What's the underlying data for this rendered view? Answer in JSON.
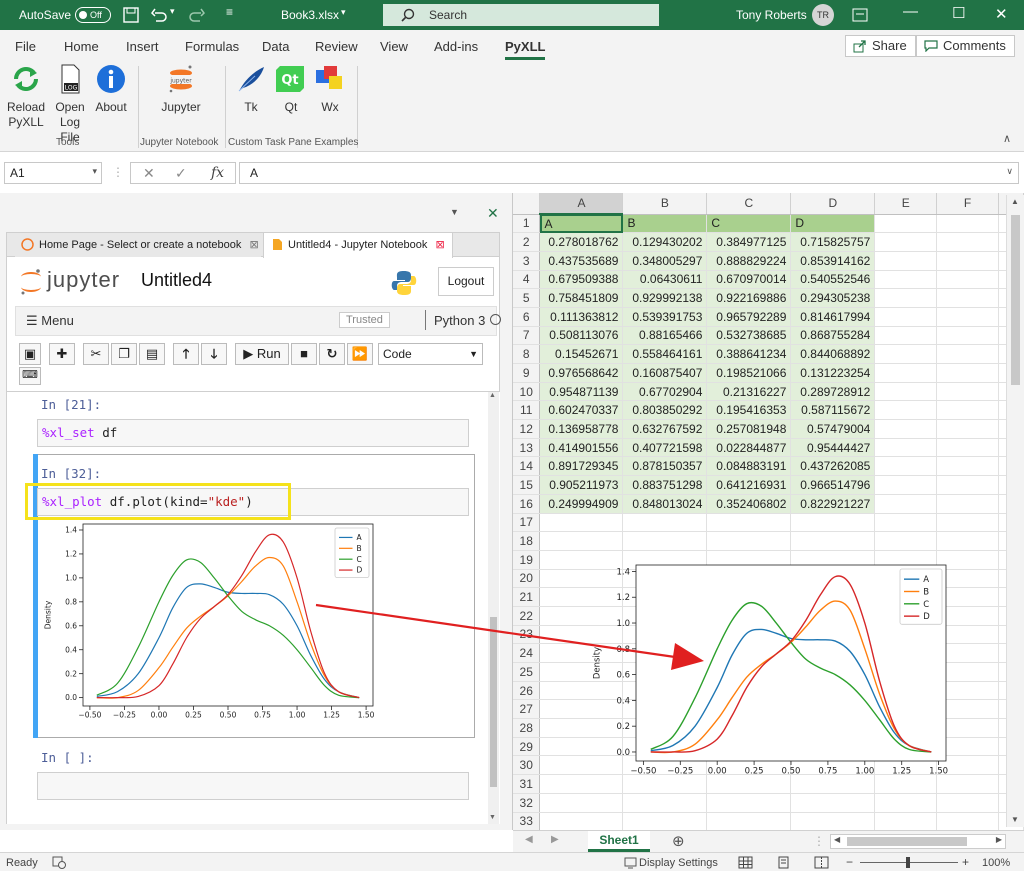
{
  "titlebar": {
    "autosave_label": "AutoSave",
    "autosave_state": "Off",
    "filename": "Book3.xlsx",
    "search_placeholder": "Search",
    "user": "Tony Roberts",
    "initials": "TR"
  },
  "menu": {
    "items": [
      "File",
      "Home",
      "Insert",
      "Formulas",
      "Data",
      "Review",
      "View",
      "Add-ins",
      "PyXLL"
    ],
    "active": "PyXLL",
    "share": "Share",
    "comments": "Comments"
  },
  "ribbon": {
    "buttons": [
      {
        "label1": "Reload",
        "label2": "PyXLL"
      },
      {
        "label1": "Open",
        "label2": "Log File"
      },
      {
        "label1": "About",
        "label2": ""
      },
      {
        "label1": "Jupyter",
        "label2": ""
      },
      {
        "label1": "Tk",
        "label2": ""
      },
      {
        "label1": "Qt",
        "label2": ""
      },
      {
        "label1": "Wx",
        "label2": ""
      }
    ],
    "groups": [
      "Tools",
      "Jupyter Notebook",
      "Custom Task Pane Examples"
    ]
  },
  "formula_bar": {
    "cell_ref": "A1",
    "content": "A"
  },
  "sheet": {
    "columns": [
      "A",
      "B",
      "C",
      "D",
      "E",
      "F"
    ],
    "headers": [
      "A",
      "B",
      "C",
      "D"
    ],
    "rows": [
      [
        "0.278018762",
        "0.129430202",
        "0.384977125",
        "0.715825757"
      ],
      [
        "0.437535689",
        "0.348005297",
        "0.888829224",
        "0.853914162"
      ],
      [
        "0.679509388",
        "0.06430611",
        "0.670970014",
        "0.540552546"
      ],
      [
        "0.758451809",
        "0.929992138",
        "0.922169886",
        "0.294305238"
      ],
      [
        "0.111363812",
        "0.539391753",
        "0.965792289",
        "0.814617994"
      ],
      [
        "0.508113076",
        "0.88165466",
        "0.532738685",
        "0.868755284"
      ],
      [
        "0.15452671",
        "0.558464161",
        "0.388641234",
        "0.844068892"
      ],
      [
        "0.976568642",
        "0.160875407",
        "0.198521066",
        "0.131223254"
      ],
      [
        "0.954871139",
        "0.67702904",
        "0.21316227",
        "0.289728912"
      ],
      [
        "0.602470337",
        "0.803850292",
        "0.195416353",
        "0.587115672"
      ],
      [
        "0.136958778",
        "0.632767592",
        "0.257081948",
        "0.57479004"
      ],
      [
        "0.414901556",
        "0.407721598",
        "0.022844877",
        "0.95444427"
      ],
      [
        "0.891729345",
        "0.878150357",
        "0.084883191",
        "0.437262085"
      ],
      [
        "0.905211973",
        "0.883751298",
        "0.641216931",
        "0.966514796"
      ],
      [
        "0.249994909",
        "0.848013024",
        "0.352406802",
        "0.822921227"
      ]
    ],
    "row_numbers": [
      "1",
      "2",
      "3",
      "4",
      "5",
      "6",
      "7",
      "8",
      "9",
      "10",
      "11",
      "12",
      "13",
      "14",
      "15",
      "16",
      "17",
      "18",
      "19",
      "20",
      "21",
      "22",
      "23",
      "24",
      "25",
      "26",
      "27",
      "28",
      "29",
      "30",
      "31",
      "32",
      "33"
    ],
    "tab": "Sheet1"
  },
  "status": {
    "ready": "Ready",
    "display_settings": "Display Settings",
    "zoom": "100%"
  },
  "browser": {
    "tabs": [
      "Home Page - Select or create a notebook",
      "Untitled4 - Jupyter Notebook"
    ]
  },
  "jupyter": {
    "logo_text": "jupyter",
    "notebook_name": "Untitled4",
    "logout": "Logout",
    "menu_label": "Menu",
    "trusted": "Trusted",
    "kernel": "Python 3",
    "run_label": "Run",
    "cell_type": "Code",
    "cells": [
      {
        "prompt": "In [21]:",
        "magic": "%xl_set",
        "code": " df"
      },
      {
        "prompt": "In [32]:",
        "magic": "%xl_plot",
        "code": " df.plot(kind=",
        "string": "\"kde\"",
        "close": ")"
      },
      {
        "prompt": "In [ ]:",
        "code": ""
      }
    ]
  },
  "colors": {
    "excel_green": "#217346",
    "series": [
      "#1f77b4",
      "#ff7f0e",
      "#2ca02c",
      "#d62728"
    ],
    "highlight": "#ffe600",
    "arrow": "#e02020"
  },
  "chart_data": [
    {
      "type": "line",
      "ylabel": "Density",
      "xlim": [
        -0.55,
        1.55
      ],
      "ylim": [
        -0.07,
        1.45
      ],
      "xticks": [
        "−0.50",
        "−0.25",
        "0.00",
        "0.25",
        "0.50",
        "0.75",
        "1.00",
        "1.25",
        "1.50"
      ],
      "yticks": [
        "0.0",
        "0.2",
        "0.4",
        "0.6",
        "0.8",
        "1.0",
        "1.2",
        "1.4"
      ],
      "legend_position": "top-right",
      "x": [
        -0.45,
        -0.3,
        -0.15,
        0,
        0.1,
        0.2,
        0.3,
        0.4,
        0.5,
        0.6,
        0.7,
        0.8,
        0.9,
        1,
        1.1,
        1.2,
        1.3,
        1.45
      ],
      "series": [
        {
          "name": "A",
          "values": [
            0.01,
            0.05,
            0.2,
            0.5,
            0.75,
            0.92,
            0.95,
            0.92,
            0.88,
            0.87,
            0.87,
            0.86,
            0.78,
            0.6,
            0.35,
            0.15,
            0.05,
            0
          ]
        },
        {
          "name": "B",
          "values": [
            0,
            0,
            0.06,
            0.25,
            0.42,
            0.58,
            0.68,
            0.76,
            0.85,
            0.97,
            1.1,
            1.17,
            1.1,
            0.8,
            0.45,
            0.18,
            0.05,
            0
          ]
        },
        {
          "name": "C",
          "values": [
            0.02,
            0.12,
            0.42,
            0.8,
            1.02,
            1.15,
            1.13,
            1.0,
            0.85,
            0.72,
            0.65,
            0.6,
            0.52,
            0.4,
            0.25,
            0.1,
            0.02,
            0
          ]
        },
        {
          "name": "D",
          "values": [
            0,
            0,
            0.01,
            0.1,
            0.28,
            0.5,
            0.66,
            0.76,
            0.86,
            1.02,
            1.22,
            1.36,
            1.3,
            1.0,
            0.55,
            0.2,
            0.05,
            0
          ]
        }
      ]
    },
    {
      "type": "line",
      "ylabel": "Density",
      "xlim": [
        -0.55,
        1.55
      ],
      "ylim": [
        -0.07,
        1.45
      ],
      "xticks": [
        "−0.50",
        "−0.25",
        "0.00",
        "0.25",
        "0.50",
        "0.75",
        "1.00",
        "1.25",
        "1.50"
      ],
      "yticks": [
        "0.0",
        "0.2",
        "0.4",
        "0.6",
        "0.8",
        "1.0",
        "1.2",
        "1.4"
      ],
      "legend_position": "top-right",
      "x": [
        -0.45,
        -0.3,
        -0.15,
        0,
        0.1,
        0.2,
        0.3,
        0.4,
        0.5,
        0.6,
        0.7,
        0.8,
        0.9,
        1,
        1.1,
        1.2,
        1.3,
        1.45
      ],
      "series": [
        {
          "name": "A",
          "values": [
            0.01,
            0.05,
            0.2,
            0.5,
            0.75,
            0.92,
            0.95,
            0.92,
            0.88,
            0.87,
            0.87,
            0.86,
            0.78,
            0.6,
            0.35,
            0.15,
            0.05,
            0
          ]
        },
        {
          "name": "B",
          "values": [
            0,
            0,
            0.06,
            0.25,
            0.42,
            0.58,
            0.68,
            0.76,
            0.85,
            0.97,
            1.1,
            1.17,
            1.1,
            0.8,
            0.45,
            0.18,
            0.05,
            0
          ]
        },
        {
          "name": "C",
          "values": [
            0.02,
            0.12,
            0.42,
            0.8,
            1.02,
            1.15,
            1.13,
            1.0,
            0.85,
            0.72,
            0.65,
            0.6,
            0.52,
            0.4,
            0.25,
            0.1,
            0.02,
            0
          ]
        },
        {
          "name": "D",
          "values": [
            0,
            0,
            0.01,
            0.1,
            0.28,
            0.5,
            0.66,
            0.76,
            0.86,
            1.02,
            1.22,
            1.36,
            1.3,
            1.0,
            0.55,
            0.2,
            0.05,
            0
          ]
        }
      ]
    }
  ]
}
